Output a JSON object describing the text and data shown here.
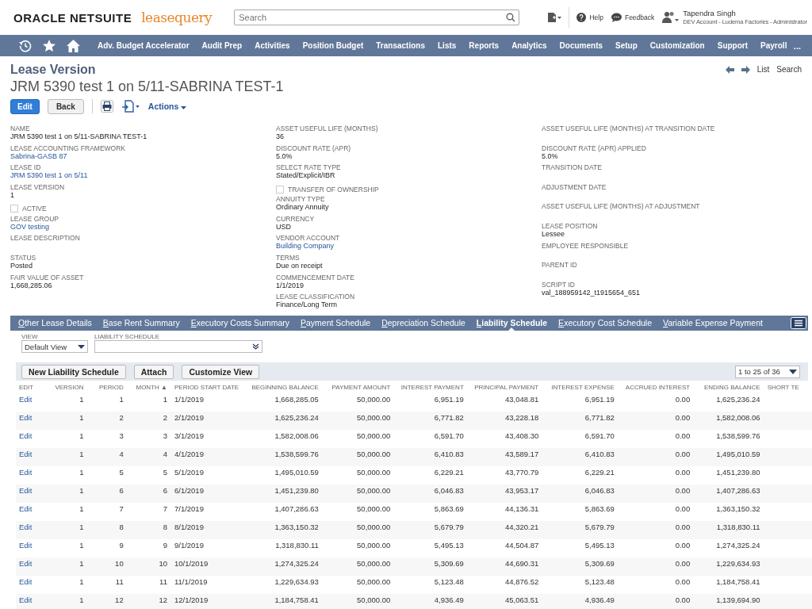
{
  "header": {
    "brand": "ORACLE NETSUITE",
    "partner_logo": "leasequery",
    "search": {
      "placeholder": "Search"
    },
    "help": "Help",
    "feedback": "Feedback",
    "user": {
      "name": "Tapendra Singh",
      "account": "DEV Account - Ludema Factories - Administrator"
    }
  },
  "nav": {
    "items": [
      "Adv. Budget Accelerator",
      "Audit Prep",
      "Activities",
      "Position Budget",
      "Transactions",
      "Lists",
      "Reports",
      "Analytics",
      "Documents",
      "Setup",
      "Customization",
      "Support",
      "Payroll"
    ],
    "more": "..."
  },
  "page": {
    "type": "Lease Version",
    "record_name": "JRM 5390 test 1 on 5/11-SABRINA TEST-1",
    "links": [
      "List",
      "Search"
    ],
    "buttons": {
      "edit": "Edit",
      "back": "Back",
      "actions": "Actions"
    }
  },
  "fields": [
    [
      {
        "kind": "text",
        "label": "NAME",
        "value": "JRM 5390 test 1 on 5/11-SABRINA TEST-1"
      },
      {
        "kind": "link",
        "label": "LEASE ACCOUNTING FRAMEWORK",
        "value": "Sabrina-GASB 87"
      },
      {
        "kind": "link",
        "label": "LEASE ID",
        "value": "JRM 5390 test 1 on 5/11"
      },
      {
        "kind": "text",
        "label": "LEASE VERSION",
        "value": "1"
      },
      {
        "kind": "checkbox",
        "label": "ACTIVE",
        "checked": false
      },
      {
        "kind": "link",
        "label": "LEASE GROUP",
        "value": "GOV testing"
      },
      {
        "kind": "text",
        "label": "LEASE DESCRIPTION"
      },
      {
        "kind": "text",
        "label": "STATUS",
        "value": "Posted"
      },
      {
        "kind": "text",
        "label": "FAIR VALUE OF ASSET",
        "value": "1,668,285.06"
      }
    ],
    [
      {
        "kind": "text",
        "label": "ASSET USEFUL LIFE (MONTHS)",
        "value": "36"
      },
      {
        "kind": "text",
        "label": "DISCOUNT RATE (APR)",
        "value": "5.0%"
      },
      {
        "kind": "text",
        "label": "SELECT RATE TYPE",
        "value": "Stated/Explicit/IBR"
      },
      {
        "kind": "checkbox",
        "label": "TRANSFER OF OWNERSHIP",
        "checked": false
      },
      {
        "kind": "text",
        "label": "ANNUITY TYPE",
        "value": "Ordinary Annuity"
      },
      {
        "kind": "text",
        "label": "CURRENCY",
        "value": "USD"
      },
      {
        "kind": "link",
        "label": "VENDOR ACCOUNT",
        "value": "Building Company"
      },
      {
        "kind": "text",
        "label": "TERMS",
        "value": "Due on receipt"
      },
      {
        "kind": "text",
        "label": "COMMENCEMENT DATE",
        "value": "1/1/2019"
      },
      {
        "kind": "text",
        "label": "LEASE CLASSIFICATION",
        "value": "Finance/Long Term"
      }
    ],
    [
      {
        "kind": "text",
        "label": "ASSET USEFUL LIFE (MONTHS) AT TRANSITION DATE"
      },
      {
        "kind": "text",
        "label": "DISCOUNT RATE (APR) APPLIED",
        "value": "5.0%"
      },
      {
        "kind": "text",
        "label": "TRANSITION DATE"
      },
      {
        "kind": "text",
        "label": "ADJUSTMENT DATE"
      },
      {
        "kind": "text",
        "label": "ASSET USEFUL LIFE (MONTHS) AT ADJUSTMENT"
      },
      {
        "kind": "text",
        "label": "LEASE POSITION",
        "value": "Lessee"
      },
      {
        "kind": "text",
        "label": "EMPLOYEE RESPONSIBLE"
      },
      {
        "kind": "text",
        "label": "PARENT ID"
      },
      {
        "kind": "text",
        "label": "SCRIPT ID",
        "value": "val_188959142_t1915654_651"
      }
    ]
  ],
  "subtabs": [
    {
      "label": "Other Lease Details",
      "selected": false
    },
    {
      "label": "Base Rent Summary",
      "selected": false
    },
    {
      "label": "Executory Costs Summary",
      "selected": false
    },
    {
      "label": "Payment Schedule",
      "selected": false
    },
    {
      "label": "Depreciation Schedule",
      "selected": false
    },
    {
      "label": "Liability Schedule",
      "selected": true
    },
    {
      "label": "Executory Cost Schedule",
      "selected": false
    },
    {
      "label": "Variable Expense Payment",
      "selected": false
    }
  ],
  "filters": {
    "view": {
      "label": "VIEW",
      "value": "Default View"
    },
    "schedule": {
      "label": "LIABILITY SCHEDULE"
    }
  },
  "sublist_buttons": [
    "New Liability Schedule",
    "Attach",
    "Customize View"
  ],
  "pager": "1 to 25 of 36",
  "table": {
    "columns": [
      "EDIT",
      "VERSION",
      "PERIOD",
      "MONTH ▲",
      "PERIOD START DATE",
      "BEGINNING BALANCE",
      "PAYMENT AMOUNT",
      "INTEREST PAYMENT",
      "PRINCIPAL PAYMENT",
      "INTEREST EXPENSE",
      "ACCRUED INTEREST",
      "ENDING BALANCE",
      "SHORT TE"
    ],
    "rows": [
      [
        "Edit",
        "1",
        "1",
        "1",
        "1/1/2019",
        "1,668,285.05",
        "50,000.00",
        "6,951.19",
        "43,048.81",
        "6,951.19",
        "0.00",
        "1,625,236.24"
      ],
      [
        "Edit",
        "1",
        "2",
        "2",
        "2/1/2019",
        "1,625,236.24",
        "50,000.00",
        "6,771.82",
        "43,228.18",
        "6,771.82",
        "0.00",
        "1,582,008.06"
      ],
      [
        "Edit",
        "1",
        "3",
        "3",
        "3/1/2019",
        "1,582,008.06",
        "50,000.00",
        "6,591.70",
        "43,408.30",
        "6,591.70",
        "0.00",
        "1,538,599.76"
      ],
      [
        "Edit",
        "1",
        "4",
        "4",
        "4/1/2019",
        "1,538,599.76",
        "50,000.00",
        "6,410.83",
        "43,589.17",
        "6,410.83",
        "0.00",
        "1,495,010.59"
      ],
      [
        "Edit",
        "1",
        "5",
        "5",
        "5/1/2019",
        "1,495,010.59",
        "50,000.00",
        "6,229.21",
        "43,770.79",
        "6,229.21",
        "0.00",
        "1,451,239.80"
      ],
      [
        "Edit",
        "1",
        "6",
        "6",
        "6/1/2019",
        "1,451,239.80",
        "50,000.00",
        "6,046.83",
        "43,953.17",
        "6,046.83",
        "0.00",
        "1,407,286.63"
      ],
      [
        "Edit",
        "1",
        "7",
        "7",
        "7/1/2019",
        "1,407,286.63",
        "50,000.00",
        "5,863.69",
        "44,136.31",
        "5,863.69",
        "0.00",
        "1,363,150.32"
      ],
      [
        "Edit",
        "1",
        "8",
        "8",
        "8/1/2019",
        "1,363,150.32",
        "50,000.00",
        "5,679.79",
        "44,320.21",
        "5,679.79",
        "0.00",
        "1,318,830.11"
      ],
      [
        "Edit",
        "1",
        "9",
        "9",
        "9/1/2019",
        "1,318,830.11",
        "50,000.00",
        "5,495.13",
        "44,504.87",
        "5,495.13",
        "0.00",
        "1,274,325.24"
      ],
      [
        "Edit",
        "1",
        "10",
        "10",
        "10/1/2019",
        "1,274,325.24",
        "50,000.00",
        "5,309.69",
        "44,690.31",
        "5,309.69",
        "0.00",
        "1,229,634.93"
      ],
      [
        "Edit",
        "1",
        "11",
        "11",
        "11/1/2019",
        "1,229,634.93",
        "50,000.00",
        "5,123.48",
        "44,876.52",
        "5,123.48",
        "0.00",
        "1,184,758.41"
      ],
      [
        "Edit",
        "1",
        "12",
        "12",
        "12/1/2019",
        "1,184,758.41",
        "50,000.00",
        "4,936.49",
        "45,063.51",
        "4,936.49",
        "0.00",
        "1,139,694.90"
      ]
    ]
  }
}
